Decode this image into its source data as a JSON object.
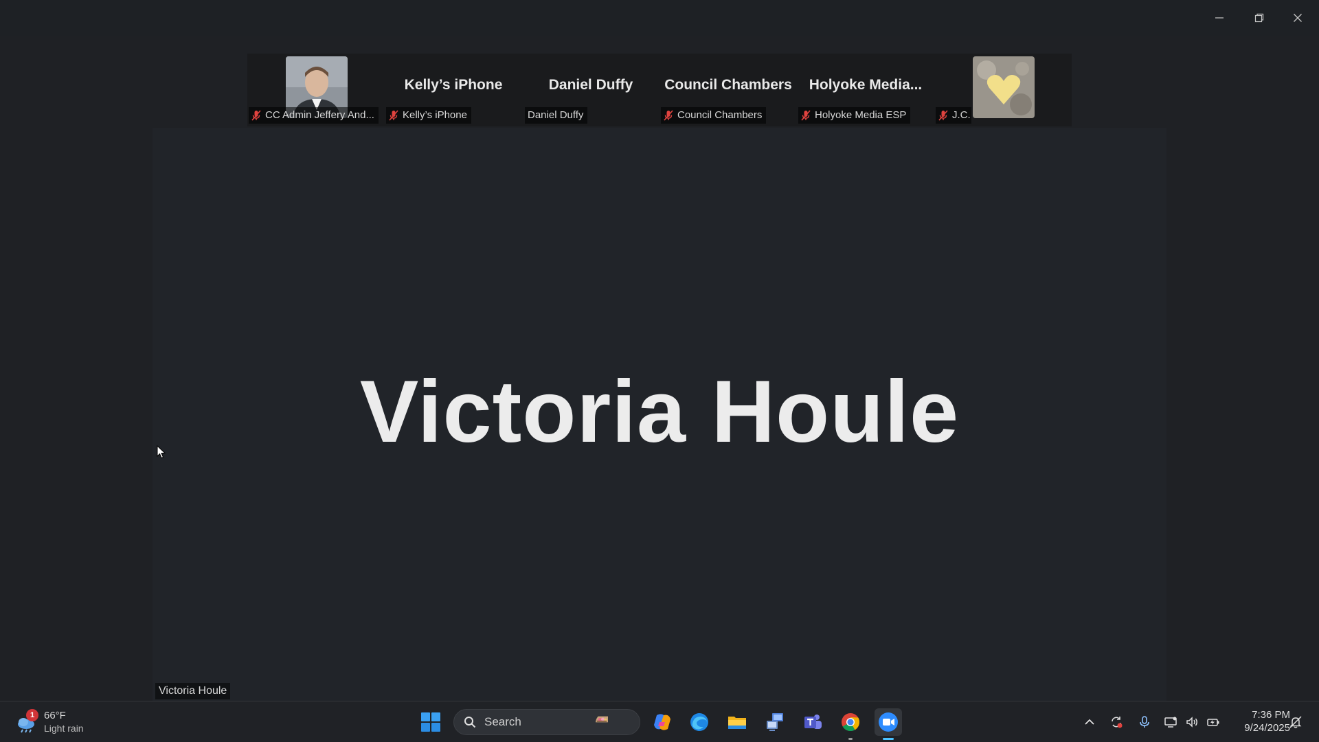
{
  "window": {
    "controls": {
      "minimize": "minimize-icon",
      "restore": "restore-icon",
      "close": "close-icon"
    }
  },
  "participants": [
    {
      "display": "avatar",
      "label": "CC Admin Jeffery And...",
      "muted": true,
      "icon": "person-photo"
    },
    {
      "display": "name",
      "name": "Kelly’s iPhone",
      "label": "Kelly’s iPhone",
      "muted": true
    },
    {
      "display": "name",
      "name": "Daniel Duffy",
      "label": "Daniel Duffy",
      "muted": false
    },
    {
      "display": "name",
      "name": "Council Chambers",
      "label": "Council Chambers",
      "muted": true
    },
    {
      "display": "name",
      "name": "Holyoke  Media...",
      "label": "Holyoke Media ESP",
      "muted": true
    },
    {
      "display": "avatar",
      "label": "J.C.",
      "muted": true,
      "icon": "heart-photo"
    }
  ],
  "main": {
    "speaker_name": "Victoria Houle",
    "speaker_label": "Victoria Houle"
  },
  "taskbar": {
    "weather": {
      "badge": "1",
      "temp": "66°F",
      "condition": "Light rain",
      "icon": "weather-rain-icon"
    },
    "search": {
      "placeholder": "Search"
    },
    "apps": [
      "start-icon",
      "copilot-icon",
      "edge-icon",
      "file-explorer-icon",
      "remote-app-icon",
      "teams-icon",
      "chrome-icon",
      "zoom-icon"
    ],
    "tray": [
      "chevron-up-icon",
      "sync-icon",
      "microphone-icon",
      "network-icon",
      "volume-icon",
      "battery-icon",
      "notification-icon"
    ],
    "clock": {
      "time": "7:36 PM",
      "date": "9/24/2025"
    }
  },
  "colors": {
    "background": "#1f2125",
    "taskbar": "#202226",
    "mute_red": "#e0433f",
    "accent": "#4cc2ff"
  }
}
